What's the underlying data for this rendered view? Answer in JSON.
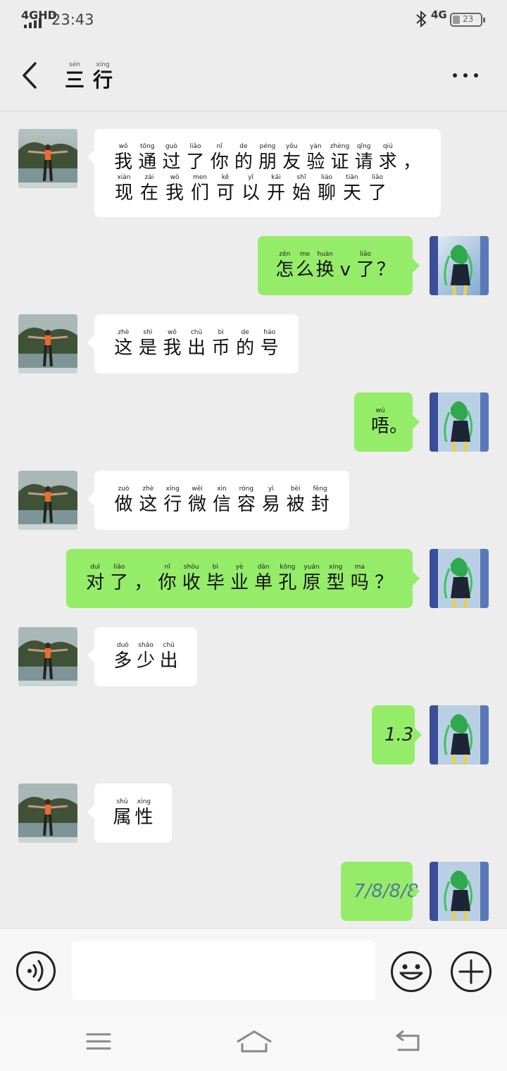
{
  "status_bar": {
    "network": "4GHD",
    "time": "23:43",
    "network_right": "4G",
    "battery": "23",
    "icons": [
      "signal-icon",
      "bluetooth-icon",
      "battery-icon"
    ]
  },
  "header": {
    "title_chars": [
      {
        "hz": "三",
        "py": "sén"
      },
      {
        "hz": "行",
        "py": "xíng"
      }
    ],
    "icons": [
      "back-arrow-icon",
      "more-options-icon"
    ]
  },
  "messages": [
    {
      "dir": "in",
      "lines": [
        [
          {
            "hz": "我",
            "py": "wǒ"
          },
          {
            "hz": "通",
            "py": "tōng"
          },
          {
            "hz": "过",
            "py": "guò"
          },
          {
            "hz": "了",
            "py": "liǎo"
          },
          {
            "hz": "你",
            "py": "nǐ"
          },
          {
            "hz": "的",
            "py": "de"
          },
          {
            "hz": "朋",
            "py": "péng"
          },
          {
            "hz": "友",
            "py": "yǒu"
          },
          {
            "hz": "验",
            "py": "yàn"
          },
          {
            "hz": "证",
            "py": "zhèng"
          },
          {
            "hz": "请",
            "py": "qǐng"
          },
          {
            "hz": "求",
            "py": "qiú"
          },
          {
            "hz": "，",
            "py": ""
          }
        ],
        [
          {
            "hz": "现",
            "py": "xiàn"
          },
          {
            "hz": "在",
            "py": "zài"
          },
          {
            "hz": "我",
            "py": "wǒ"
          },
          {
            "hz": "们",
            "py": "men"
          },
          {
            "hz": "可",
            "py": "kě"
          },
          {
            "hz": "以",
            "py": "yǐ"
          },
          {
            "hz": "开",
            "py": "kāi"
          },
          {
            "hz": "始",
            "py": "shǐ"
          },
          {
            "hz": "聊",
            "py": "liáo"
          },
          {
            "hz": "天",
            "py": "tiān"
          },
          {
            "hz": "了",
            "py": "liǎo"
          }
        ]
      ]
    },
    {
      "dir": "out",
      "lines": [
        [
          {
            "hz": "怎",
            "py": "zěn"
          },
          {
            "hz": "么",
            "py": "me"
          },
          {
            "hz": "换",
            "py": "huàn"
          },
          {
            "hz": "v",
            "py": ""
          },
          {
            "hz": "了",
            "py": "liǎo"
          },
          {
            "hz": "？",
            "py": ""
          }
        ]
      ]
    },
    {
      "dir": "in",
      "lines": [
        [
          {
            "hz": "这",
            "py": "zhè"
          },
          {
            "hz": "是",
            "py": "shì"
          },
          {
            "hz": "我",
            "py": "wǒ"
          },
          {
            "hz": "出",
            "py": "chū"
          },
          {
            "hz": "币",
            "py": "bì"
          },
          {
            "hz": "的",
            "py": "de"
          },
          {
            "hz": "号",
            "py": "hào"
          }
        ]
      ]
    },
    {
      "dir": "out",
      "lines": [
        [
          {
            "hz": "唔",
            "py": "wú"
          },
          {
            "hz": "。",
            "py": ""
          }
        ]
      ]
    },
    {
      "dir": "in",
      "lines": [
        [
          {
            "hz": "做",
            "py": "zuò"
          },
          {
            "hz": "这",
            "py": "zhè"
          },
          {
            "hz": "行",
            "py": "xíng"
          },
          {
            "hz": "微",
            "py": "wēi"
          },
          {
            "hz": "信",
            "py": "xìn"
          },
          {
            "hz": "容",
            "py": "róng"
          },
          {
            "hz": "易",
            "py": "yì"
          },
          {
            "hz": "被",
            "py": "bèi"
          },
          {
            "hz": "封",
            "py": "fēng"
          }
        ]
      ]
    },
    {
      "dir": "out",
      "lines": [
        [
          {
            "hz": "对",
            "py": "duì"
          },
          {
            "hz": "了",
            "py": "liǎo"
          },
          {
            "hz": "，",
            "py": ""
          },
          {
            "hz": "你",
            "py": "nǐ"
          },
          {
            "hz": "收",
            "py": "shōu"
          },
          {
            "hz": "毕",
            "py": "bì"
          },
          {
            "hz": "业",
            "py": "yè"
          },
          {
            "hz": "单",
            "py": "dān"
          },
          {
            "hz": "孔",
            "py": "kǒng"
          },
          {
            "hz": "原",
            "py": "yuán"
          },
          {
            "hz": "型",
            "py": "xíng"
          },
          {
            "hz": "吗",
            "py": "ma"
          },
          {
            "hz": "？",
            "py": ""
          }
        ]
      ]
    },
    {
      "dir": "in",
      "lines": [
        [
          {
            "hz": "多",
            "py": "duō"
          },
          {
            "hz": "少",
            "py": "shǎo"
          },
          {
            "hz": "出",
            "py": "chū"
          }
        ]
      ]
    },
    {
      "dir": "out",
      "text": "1.3"
    },
    {
      "dir": "in",
      "lines": [
        [
          {
            "hz": "属",
            "py": "shǔ"
          },
          {
            "hz": "性",
            "py": "xìng"
          }
        ]
      ]
    },
    {
      "dir": "out",
      "text": "7/8/8/8"
    }
  ],
  "input_bar": {
    "text_value": "",
    "icons": [
      "voice-icon",
      "emoji-icon",
      "plus-icon"
    ]
  },
  "nav_bar": {
    "icons": [
      "menu-icon",
      "home-icon",
      "back-icon"
    ]
  },
  "colors": {
    "background": "#ededed",
    "bubble_in": "#ffffff",
    "bubble_out": "#95ec69"
  }
}
